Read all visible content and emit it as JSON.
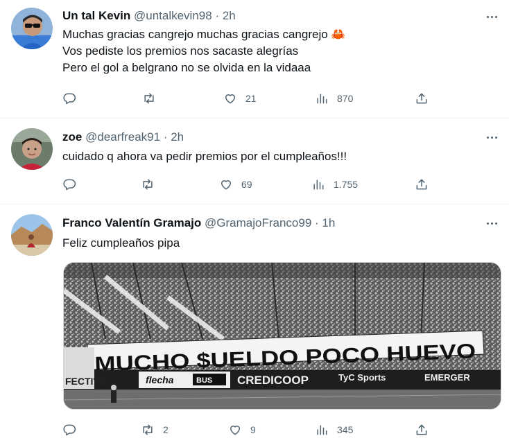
{
  "tweets": [
    {
      "name": "Un tal Kevin",
      "handle": "@untalkevin98",
      "separator": "·",
      "time": "2h",
      "lines": [
        "Muchas gracias cangrejo muchas gracias cangrejo 🦀",
        "Vos pediste los premios nos sacaste alegrías",
        "Pero el gol a belgrano no se olvida en la vidaaa"
      ],
      "stats": {
        "replies": "",
        "retweets": "",
        "likes": "21",
        "views": "870"
      }
    },
    {
      "name": "zoe",
      "handle": "@dearfreak91",
      "separator": "·",
      "time": "2h",
      "lines": [
        "cuidado q ahora va pedir premios por el cumpleaños!!!"
      ],
      "stats": {
        "replies": "",
        "retweets": "",
        "likes": "69",
        "views": "1.755"
      }
    },
    {
      "name": "Franco Valentín Gramajo",
      "handle": "@GramajoFranco99",
      "separator": "·",
      "time": "1h",
      "lines": [
        "Feliz cumpleaños pipa"
      ],
      "media": {
        "banner_text": "MUCHO $UELDO POCO HUEVO",
        "ads": [
          "flecha",
          "BUS",
          "CREDICOOP",
          "TyC Sports",
          "EMERGER",
          "FECTIVO"
        ]
      },
      "stats": {
        "replies": "",
        "retweets": "2",
        "likes": "9",
        "views": "345"
      }
    }
  ],
  "icons": {
    "reply": "reply-icon",
    "retweet": "retweet-icon",
    "like": "heart-icon",
    "views": "views-icon",
    "share": "share-icon",
    "more": "more-icon"
  },
  "colors": {
    "text": "#0f1419",
    "secondary": "#536471",
    "divider": "#eff3f4"
  }
}
